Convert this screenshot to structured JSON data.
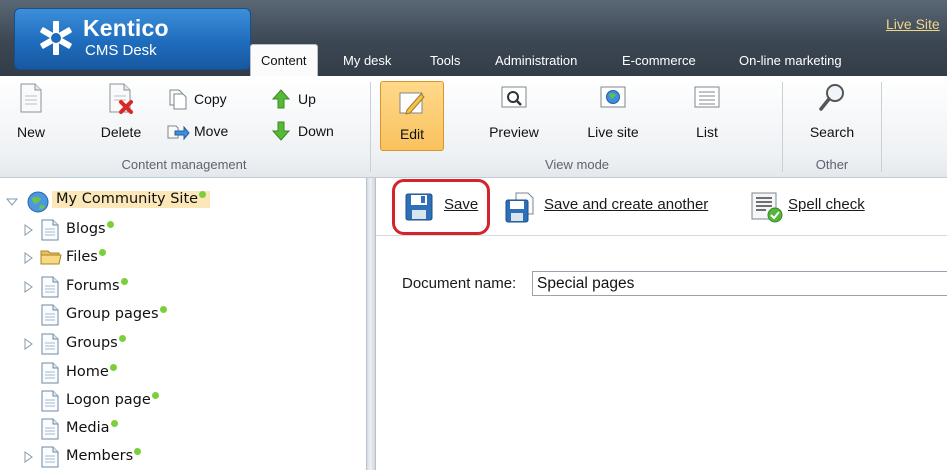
{
  "header": {
    "brand_name": "Kentico",
    "brand_subtitle": "CMS Desk",
    "live_site_link": "Live Site",
    "tabs": [
      {
        "label": "Content",
        "active": true
      },
      {
        "label": "My desk"
      },
      {
        "label": "Tools"
      },
      {
        "label": "Administration"
      },
      {
        "label": "E-commerce"
      },
      {
        "label": "On-line marketing"
      }
    ]
  },
  "toolbar": {
    "content_management": {
      "group_label": "Content management",
      "new": "New",
      "delete": "Delete",
      "copy": "Copy",
      "move": "Move",
      "up": "Up",
      "down": "Down"
    },
    "view_mode": {
      "group_label": "View mode",
      "edit": "Edit",
      "preview": "Preview",
      "live_site": "Live site",
      "list": "List",
      "selected": "Edit"
    },
    "other": {
      "group_label": "Other",
      "search": "Search"
    }
  },
  "tree": {
    "root": "My Community Site",
    "items": [
      {
        "label": "Blogs",
        "expandable": true,
        "icon": "page-icon"
      },
      {
        "label": "Files",
        "expandable": true,
        "icon": "folder-icon"
      },
      {
        "label": "Forums",
        "expandable": true,
        "icon": "page-icon"
      },
      {
        "label": "Group pages",
        "expandable": false,
        "icon": "page-icon"
      },
      {
        "label": "Groups",
        "expandable": true,
        "icon": "page-icon"
      },
      {
        "label": "Home",
        "expandable": false,
        "icon": "page-icon"
      },
      {
        "label": "Logon page",
        "expandable": false,
        "icon": "page-icon"
      },
      {
        "label": "Media",
        "expandable": false,
        "icon": "page-icon"
      },
      {
        "label": "Members",
        "expandable": true,
        "icon": "page-icon"
      }
    ]
  },
  "editor": {
    "save": "Save",
    "save_and_create": "Save and create another",
    "spell_check": "Spell check",
    "document_name_label": "Document name:",
    "document_name_value": "Special pages"
  },
  "colors": {
    "header_bg": "#3c4753",
    "logo_blue": "#1f6cbd",
    "selected_orange": "#f9c25e",
    "highlight_red": "#d4232a",
    "status_dot_green": "#7bcf3a"
  }
}
